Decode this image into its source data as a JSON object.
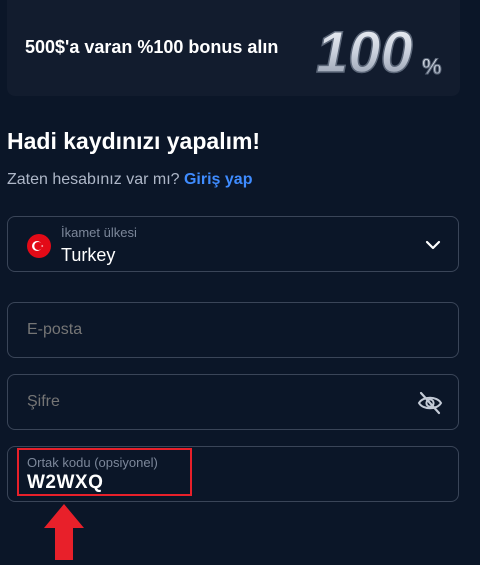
{
  "banner": {
    "text": "500$'a varan %100 bonus alın",
    "graphic_text": "100",
    "graphic_suffix": "%"
  },
  "form": {
    "title": "Hadi kaydınızı yapalım!",
    "subtitle_prefix": "Zaten hesabınız var mı?",
    "login_link": "Giriş yap",
    "country": {
      "label": "İkamet ülkesi",
      "value": "Turkey",
      "flag_icon": "turkey-flag-icon"
    },
    "email": {
      "placeholder": "E-posta"
    },
    "password": {
      "placeholder": "Şifre",
      "toggle_icon": "eye-slash-icon"
    },
    "referral": {
      "label": "Ortak kodu (opsiyonel)",
      "value": "W2WXQ"
    }
  },
  "colors": {
    "background": "#0b1628",
    "link": "#3f8cff",
    "highlight": "#e8202a",
    "field_border": "#3a4558"
  }
}
